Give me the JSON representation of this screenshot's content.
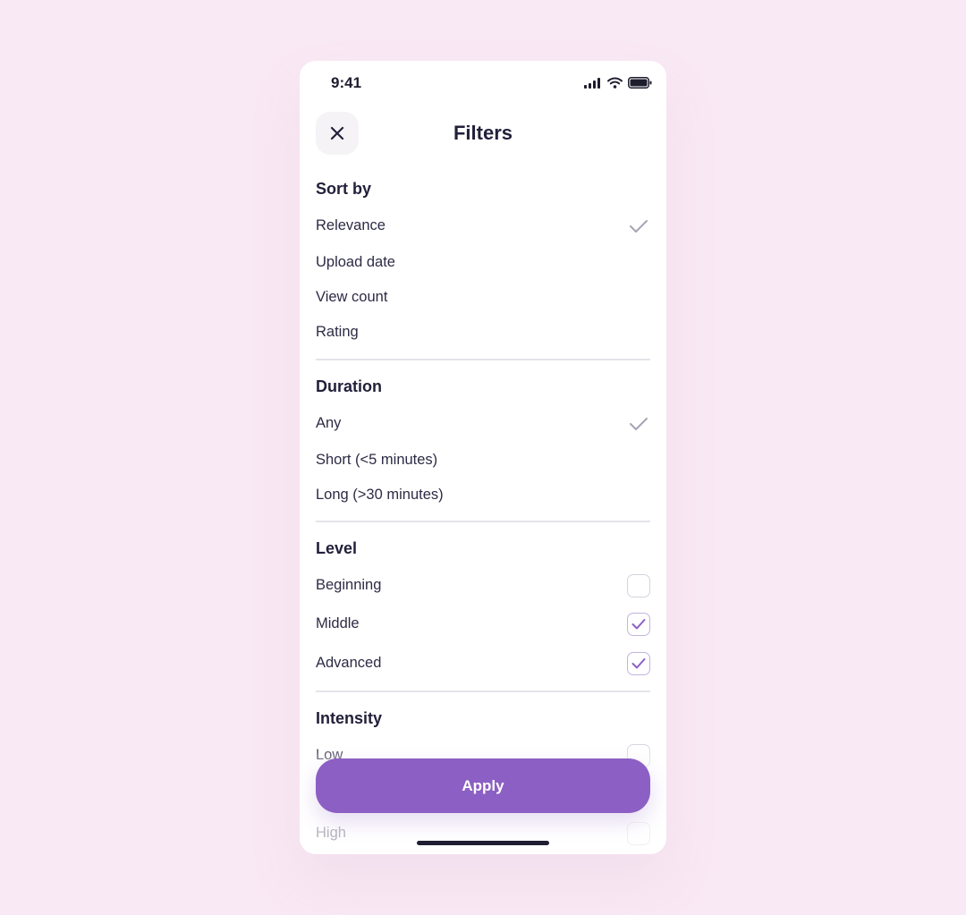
{
  "status_bar": {
    "time": "9:41"
  },
  "header": {
    "title": "Filters"
  },
  "sections": {
    "sort_by": {
      "title": "Sort by",
      "options": [
        {
          "label": "Relevance",
          "selected": true
        },
        {
          "label": "Upload date",
          "selected": false
        },
        {
          "label": "View count",
          "selected": false
        },
        {
          "label": "Rating",
          "selected": false
        }
      ]
    },
    "duration": {
      "title": "Duration",
      "options": [
        {
          "label": "Any",
          "selected": true
        },
        {
          "label": "Short (<5 minutes)",
          "selected": false
        },
        {
          "label": "Long (>30 minutes)",
          "selected": false
        }
      ]
    },
    "level": {
      "title": "Level",
      "options": [
        {
          "label": "Beginning",
          "checked": false
        },
        {
          "label": "Middle",
          "checked": true
        },
        {
          "label": "Advanced",
          "checked": true
        }
      ]
    },
    "intensity": {
      "title": "Intensity",
      "options": [
        {
          "label": "Low",
          "checked": false
        },
        {
          "label": "High",
          "checked": false
        }
      ]
    }
  },
  "apply_button": {
    "label": "Apply"
  },
  "colors": {
    "background": "#f9e9f4",
    "accent": "#8c5fc4",
    "text": "#22203a",
    "check_gray": "#a7a3b5"
  },
  "icons": {
    "close": "close-icon",
    "selected": "check-icon",
    "checkbox": "checkbox-check-icon"
  }
}
